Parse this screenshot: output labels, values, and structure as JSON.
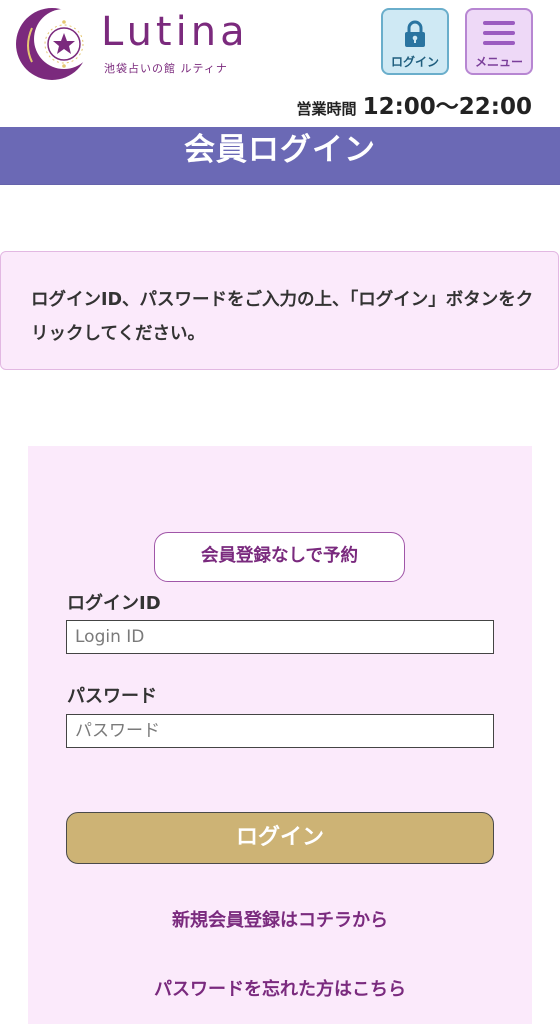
{
  "header": {
    "logo": {
      "name": "Lutina",
      "subtitle": "池袋占いの館 ルティナ",
      "icon": "crescent-moon-star-icon"
    },
    "login_button": {
      "label": "ログイン",
      "icon": "lock-icon"
    },
    "menu_button": {
      "label": "メニュー",
      "icon": "hamburger-icon"
    },
    "hours": {
      "label": "営業時間",
      "value": "12:00〜22:00"
    }
  },
  "page": {
    "title": "会員ログイン"
  },
  "notice": {
    "text": "ログインID、パスワードをご入力の上、「ログイン」ボタンをクリックしてください。"
  },
  "form": {
    "guest_button": "会員登録なしで予約",
    "login_id": {
      "label": "ログインID",
      "placeholder": "Login ID",
      "value": ""
    },
    "password": {
      "label": "パスワード",
      "placeholder": "パスワード",
      "value": ""
    },
    "submit": "ログイン",
    "register_link": "新規会員登録はコチラから",
    "forgot_link": "パスワードを忘れた方はこちら"
  },
  "colors": {
    "brand": "#7b2a7d",
    "title_bar": "#6b69b5",
    "panel": "#fbeafb",
    "login_button": "#cdb375",
    "login_header_button": "#cfe9f4",
    "menu_header_button": "#eed9f7"
  }
}
